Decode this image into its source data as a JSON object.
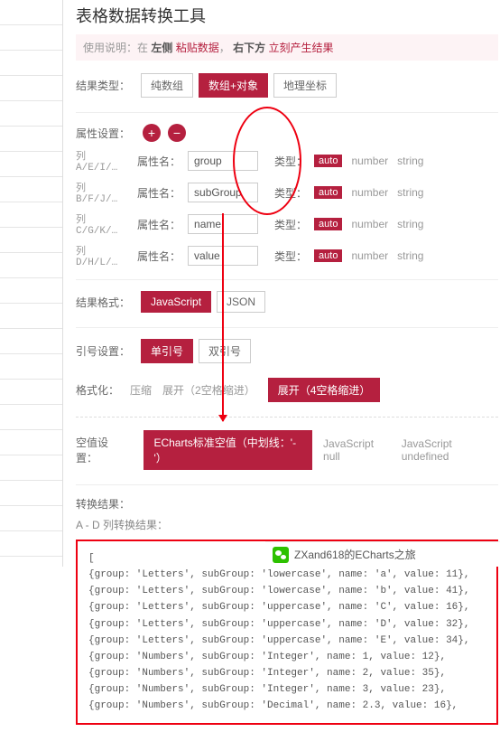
{
  "title": "表格数据转换工具",
  "usage": {
    "prefix": "使用说明：在",
    "left": "左侧",
    "paste": "粘贴数据",
    "right": "右下方",
    "result": "立刻产生结果"
  },
  "resultType": {
    "label": "结果类型：",
    "opts": [
      "纯数组",
      "数组+对象",
      "地理坐标"
    ]
  },
  "attr": {
    "label": "属性设置：",
    "colPrefix": "列",
    "nameLabel": "属性名：",
    "typeLabel": "类型：",
    "auto": "auto",
    "number": "number",
    "string": "string",
    "rows": [
      {
        "col": "A/E/I/…",
        "val": "group"
      },
      {
        "col": "B/F/J/…",
        "val": "subGroup"
      },
      {
        "col": "C/G/K/…",
        "val": "name"
      },
      {
        "col": "D/H/L/…",
        "val": "value"
      }
    ]
  },
  "fmt": {
    "label": "结果格式：",
    "opts": [
      "JavaScript",
      "JSON"
    ]
  },
  "quote": {
    "label": "引号设置：",
    "opts": [
      "单引号",
      "双引号"
    ]
  },
  "pretty": {
    "label": "格式化：",
    "opts": [
      "压缩",
      "展开（2空格缩进）",
      "展开（4空格缩进）"
    ]
  },
  "empty": {
    "label": "空值设置：",
    "opts": [
      "ECharts标准空值（中划线：'-'）",
      "JavaScript null",
      "JavaScript undefined"
    ]
  },
  "resultLabel": "转换结果：",
  "resultSub": "A - D 列转换结果：",
  "output": [
    "[",
    "    {group: 'Letters', subGroup: 'lowercase', name: 'a', value: 11},",
    "    {group: 'Letters', subGroup: 'lowercase', name: 'b', value: 41},",
    "    {group: 'Letters', subGroup: 'uppercase', name: 'C', value: 16},",
    "    {group: 'Letters', subGroup: 'uppercase', name: 'D', value: 32},",
    "    {group: 'Letters', subGroup: 'uppercase', name: 'E', value: 34},",
    "    {group: 'Numbers', subGroup: 'Integer', name: 1, value: 12},",
    "    {group: 'Numbers', subGroup: 'Integer', name: 2, value: 35},",
    "    {group: 'Numbers', subGroup: 'Integer', name: 3, value: 23},",
    "    {group: 'Numbers', subGroup: 'Decimal', name: 2.3, value: 16},"
  ],
  "footer": "ZXand618的ECharts之旅"
}
